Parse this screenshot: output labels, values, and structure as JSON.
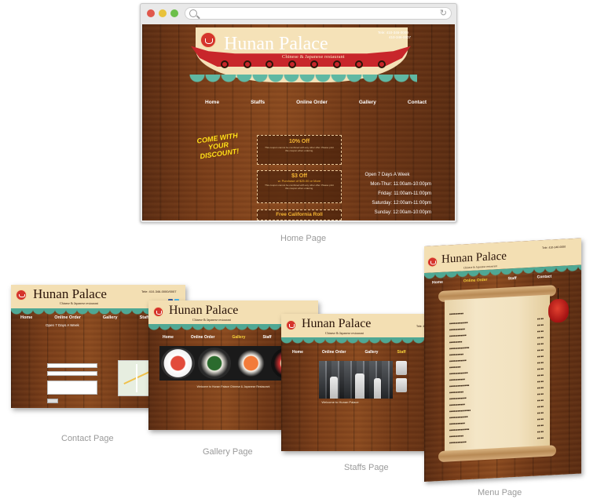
{
  "home": {
    "caption": "Home Page",
    "brand": {
      "title": "Hunan Palace",
      "subtitle": "Chinese & Japanese restaurant"
    },
    "phone": "Tele: 410-346-0000",
    "fax": "410-346-0007",
    "nav": [
      "Home",
      "Staffs",
      "Online Order",
      "Gallery",
      "Contact"
    ],
    "promo": "COME WITH YOUR DISCOUNT!",
    "coupons": [
      {
        "title": "10% Off",
        "fine": "This coupon cannot be combined with any other offer. Please print this coupon when ordering."
      },
      {
        "title": "$3 Off",
        "subtitle": "w. Purchase of $25.00 or More",
        "fine": "This coupon cannot be combined with any other offer. Please print this coupon when ordering."
      },
      {
        "title": "Free California Roll"
      }
    ],
    "hours": {
      "heading": "Open 7 Days A Week",
      "lines": [
        "Mon-Thur: 11:00am-10:00pm",
        "Friday: 11:00am-11:00pm",
        "Saturday: 12:00am-11:00pm",
        "Sunday: 12:00am-10:00pm"
      ]
    }
  },
  "thumbs": {
    "contact": {
      "caption": "Contact Page",
      "title": "Hunan Palace",
      "subtitle": "Chinese & Japanese restaurant",
      "phone": "Tele: 410-346-0000/0007",
      "nav": [
        "Home",
        "Online Order",
        "Gallery",
        "Staff"
      ],
      "heading": "Open 7 Days A Week"
    },
    "gallery": {
      "caption": "Gallery Page",
      "title": "Hunan Palace",
      "subtitle": "Chinese & Japanese restaurant",
      "nav": [
        "Home",
        "Online Order",
        "Gallery",
        "Staff"
      ],
      "welcome": "Welcome to Hunan Palace Chinese & Japanese Restaurant"
    },
    "staffs": {
      "caption": "Staffs Page",
      "title": "Hunan Palace",
      "subtitle": "Chinese & Japanese restaurant",
      "phone": "Tele: 410-346-0000",
      "nav": [
        "Home",
        "Online Order",
        "Gallery",
        "Staff"
      ],
      "welcome": "Welcome to Hunan Palace"
    },
    "menu": {
      "caption": "Menu Page",
      "title": "Hunan Palace",
      "subtitle": "Chinese & Japanese restaurant",
      "phone": "Tele: 410-346-0000",
      "nav": [
        "Home",
        "Online Order",
        "Staff",
        "Contact"
      ]
    }
  },
  "colors": {
    "wood": "#7a3d19",
    "teal": "#5fb8a3",
    "red": "#c8262b",
    "cream": "#f5e2b8",
    "gold": "#f7b733"
  }
}
